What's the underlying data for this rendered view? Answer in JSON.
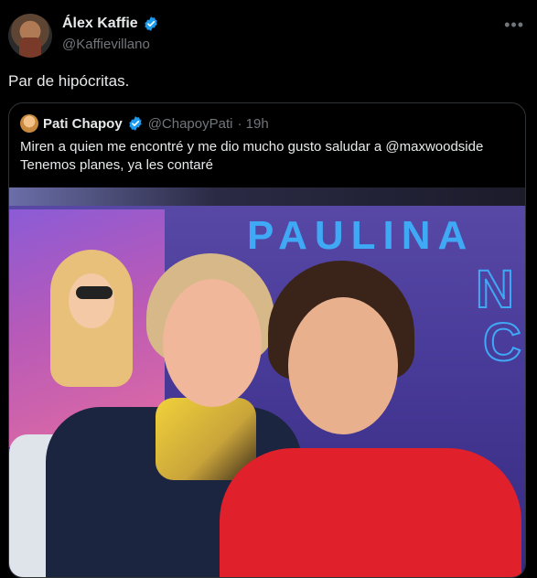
{
  "tweet": {
    "author": {
      "name": "Álex Kaffie",
      "handle": "@Kaffievillano"
    },
    "text": "Par de hipócritas."
  },
  "quoted": {
    "author": {
      "name": "Pati Chapoy",
      "handle": "@ChapoyPati"
    },
    "time": "· 19h",
    "lines": [
      "Miren a quien me encontré y me dio mucho gusto saludar a @maxwoodside",
      "Tenemos planes, ya les contaré"
    ]
  },
  "media": {
    "sign_text": "PAULINA",
    "sign_letters": [
      "N",
      "C"
    ]
  },
  "colors": {
    "accent": "#1d9bf0",
    "background": "#000000",
    "muted": "#71767b"
  },
  "icons": {
    "verified": "verified-badge-icon",
    "more": "more-options-icon"
  }
}
